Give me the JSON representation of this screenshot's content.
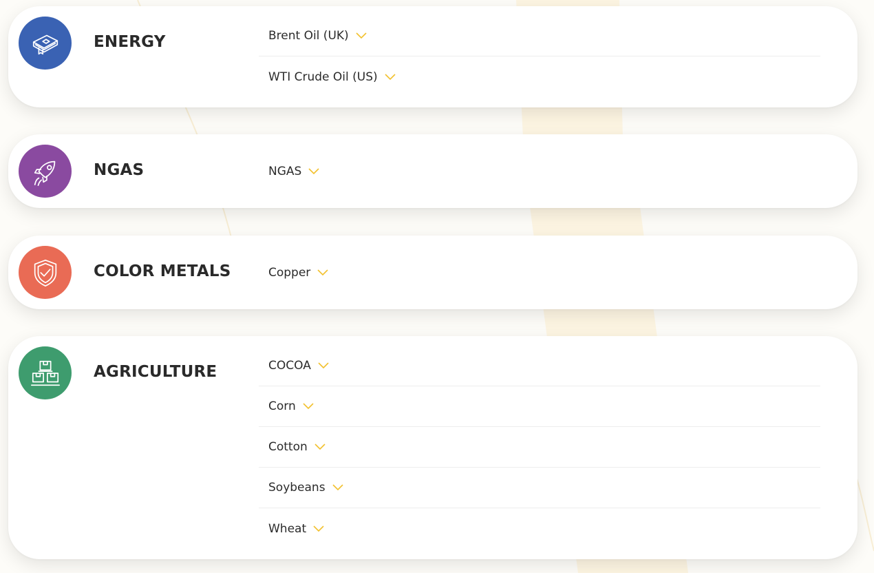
{
  "colors": {
    "chevron": "#f2c12e",
    "energy_icon_bg": "#3a62b3",
    "ngas_icon_bg": "#8a4aa0",
    "metals_icon_bg": "#e96b55",
    "agriculture_icon_bg": "#3e9c6e"
  },
  "categories": [
    {
      "title": "ENERGY",
      "icon": "book-icon",
      "items": [
        {
          "label": "Brent Oil (UK)"
        },
        {
          "label": "WTI Crude Oil (US)"
        }
      ]
    },
    {
      "title": "NGAS",
      "icon": "rocket-icon",
      "items": [
        {
          "label": "NGAS"
        }
      ]
    },
    {
      "title": "COLOR METALS",
      "icon": "shield-check-icon",
      "items": [
        {
          "label": "Copper"
        }
      ]
    },
    {
      "title": "AGRICULTURE",
      "icon": "boxes-icon",
      "items": [
        {
          "label": "COCOA"
        },
        {
          "label": "Corn"
        },
        {
          "label": "Cotton"
        },
        {
          "label": "Soybeans"
        },
        {
          "label": "Wheat"
        }
      ]
    }
  ]
}
